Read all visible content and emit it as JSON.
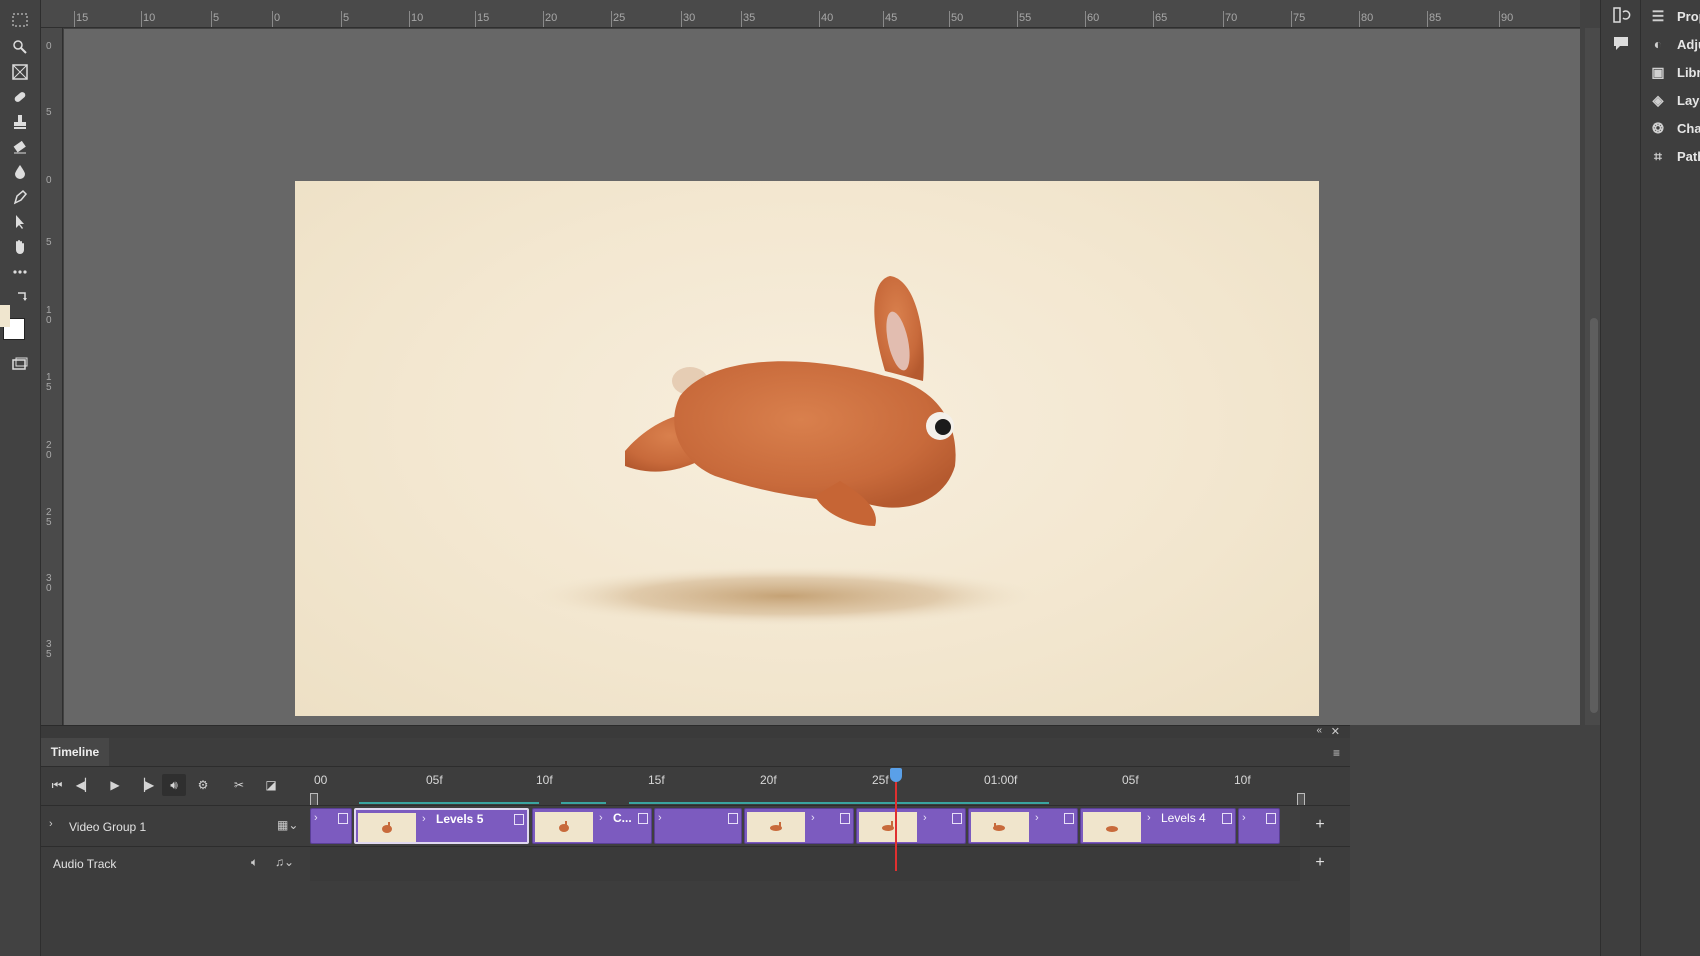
{
  "ruler_top": {
    "labels": [
      "15",
      "10",
      "5",
      "0",
      "5",
      "10",
      "15",
      "20",
      "25",
      "30",
      "35",
      "40",
      "45",
      "50",
      "55",
      "60",
      "65",
      "70",
      "75",
      "80",
      "85",
      "90"
    ]
  },
  "ruler_left": {
    "labels": [
      "0",
      "5",
      "0",
      "5",
      "1 0",
      "1 5",
      "2 0",
      "2 5",
      "3 0",
      "3 5"
    ]
  },
  "panels": {
    "items": [
      {
        "label": "Prop",
        "icon": "properties-icon"
      },
      {
        "label": "Adju",
        "icon": "adjustments-icon"
      },
      {
        "label": "Libr",
        "icon": "libraries-icon"
      },
      {
        "label": "Laye",
        "icon": "layers-icon"
      },
      {
        "label": "Chan",
        "icon": "channels-icon"
      },
      {
        "label": "Path",
        "icon": "paths-icon"
      }
    ]
  },
  "timeline": {
    "tab_label": "Timeline",
    "ruler_labels": [
      "00",
      "05f",
      "10f",
      "15f",
      "20f",
      "25f",
      "01:00f",
      "05f",
      "10f"
    ],
    "video_track_label": "Video Group 1",
    "audio_track_label": "Audio Track",
    "clips": [
      {
        "label": ""
      },
      {
        "label": "Levels 5"
      },
      {
        "label": ""
      },
      {
        "label": "C..."
      },
      {
        "label": ""
      },
      {
        "label": ""
      },
      {
        "label": ""
      },
      {
        "label": ""
      },
      {
        "label": ""
      },
      {
        "label": "Levels 4"
      },
      {
        "label": ""
      }
    ],
    "playhead_time": "26f"
  },
  "colors": {
    "clip_purple": "#7c5bbf",
    "playhead_red": "#e03030",
    "playhead_blue": "#5aa0e8",
    "foreground_swatch": "#f0e6cf",
    "background_swatch": "#ffffff"
  }
}
